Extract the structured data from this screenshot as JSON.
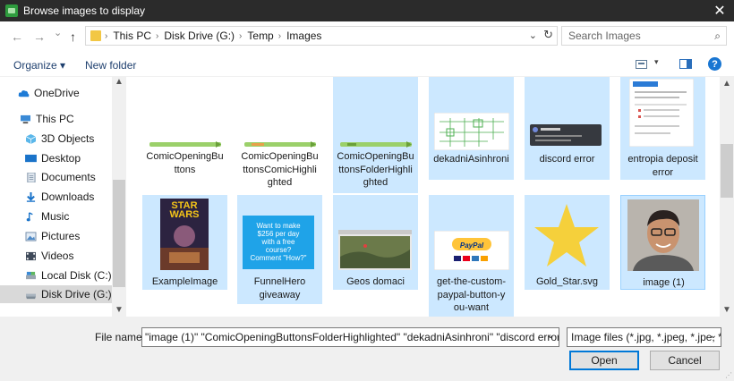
{
  "window": {
    "title": "Browse images to display",
    "close": "✕"
  },
  "nav": {
    "back": "←",
    "forward": "→",
    "recent": "⌄",
    "up": "↑"
  },
  "address": {
    "crumbs": [
      "This PC",
      "Disk Drive (G:)",
      "Temp",
      "Images"
    ],
    "sep": "›",
    "dropdown": "⌄",
    "refresh": "↻"
  },
  "search": {
    "placeholder": "Search Images",
    "icon": "⌕"
  },
  "toolbar": {
    "organize": "Organize ▾",
    "new_folder": "New folder",
    "view_dd": "▾",
    "help": "?"
  },
  "sidebar": {
    "items": [
      {
        "label": "OneDrive",
        "icon": "cloud-icon"
      },
      {
        "label": "This PC",
        "icon": "computer-icon"
      },
      {
        "label": "3D Objects",
        "icon": "cube-icon"
      },
      {
        "label": "Desktop",
        "icon": "desktop-icon"
      },
      {
        "label": "Documents",
        "icon": "document-icon"
      },
      {
        "label": "Downloads",
        "icon": "download-icon"
      },
      {
        "label": "Music",
        "icon": "music-icon"
      },
      {
        "label": "Pictures",
        "icon": "picture-icon"
      },
      {
        "label": "Videos",
        "icon": "video-icon"
      },
      {
        "label": "Local Disk (C:)",
        "icon": "drive-icon"
      },
      {
        "label": "Disk Drive (G:)",
        "icon": "drive-icon",
        "selected": true
      }
    ]
  },
  "files": [
    {
      "name": "ComicOpeningBu\nttons",
      "selected": false
    },
    {
      "name": "ComicOpeningBu\nttonsComicHighli\nghted",
      "selected": false
    },
    {
      "name": "ComicOpeningBu\nttonsFolderHighli\nghted",
      "selected": true
    },
    {
      "name": "dekadniAsinhroni",
      "selected": true
    },
    {
      "name": "discord error",
      "selected": true
    },
    {
      "name": "entropia deposit\nerror",
      "selected": true
    },
    {
      "name": "ExampleImage",
      "selected": true
    },
    {
      "name": "FunnelHero\ngiveaway",
      "selected": true
    },
    {
      "name": "Geos domaci",
      "selected": true
    },
    {
      "name": "get-the-custom-\npaypal-button-y\nou-want",
      "selected": true
    },
    {
      "name": "Gold_Star.svg",
      "selected": true
    },
    {
      "name": "image (1)",
      "selected": true
    }
  ],
  "thumbtext": {
    "star_wars": "STAR\nWARS",
    "funnel": "Want to make\n$256 per day\nwith a free\ncourse?\nComment \"How?\"",
    "paypal": "PayPal"
  },
  "bottom": {
    "filename_label": "File name:",
    "filename_value": "\"image (1)\" \"ComicOpeningButtonsFolderHighlighted\" \"dekadniAsinhroni\" \"discord error\" \"e",
    "filetype": "Image files (*.jpg, *.jpeg, *.jpe, *",
    "open": "Open",
    "cancel": "Cancel"
  },
  "colors": {
    "selection": "#cce8ff",
    "accent": "#0078d7",
    "titlebar": "#2b2b2b"
  }
}
